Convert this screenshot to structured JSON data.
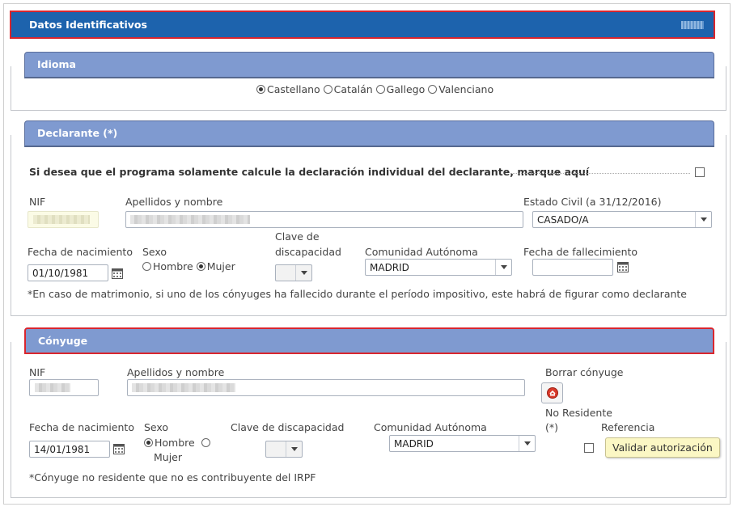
{
  "main": {
    "title": "Datos Identificativos"
  },
  "idioma": {
    "title": "Idioma",
    "options": [
      "Castellano",
      "Catalán",
      "Gallego",
      "Valenciano"
    ],
    "selected": "Castellano"
  },
  "declarante": {
    "title": "Declarante (*)",
    "individual_text": "Si desea que el programa solamente calcule la declaración individual del declarante, marque aquí",
    "nif_label": "NIF",
    "nombre_label": "Apellidos y nombre",
    "estado_civil_label": "Estado Civil (a 31/12/2016)",
    "estado_civil_value": "CASADO/A",
    "fecha_nac_label": "Fecha de nacimiento",
    "fecha_nac_value": "01/10/1981",
    "sexo_label": "Sexo",
    "sexo_hombre": "Hombre",
    "sexo_mujer": "Mujer",
    "sexo_selected": "Mujer",
    "discapacidad_label_1": "Clave de",
    "discapacidad_label_2": "discapacidad",
    "comunidad_label": "Comunidad Autónoma",
    "comunidad_value": "MADRID",
    "fallecimiento_label": "Fecha de fallecimiento",
    "note": "*En caso de matrimonio, si uno de los cónyuges ha fallecido durante el período impositivo, este habrá de figurar como declarante"
  },
  "conyuge": {
    "title": "Cónyuge",
    "nif_label": "NIF",
    "nombre_label": "Apellidos y nombre",
    "borrar_label": "Borrar cónyuge",
    "fecha_nac_label": "Fecha de nacimiento",
    "fecha_nac_value": "14/01/1981",
    "sexo_label": "Sexo",
    "sexo_hombre": "Hombre",
    "sexo_mujer": "Mujer",
    "sexo_selected": "Hombre",
    "discapacidad_label": "Clave de discapacidad",
    "comunidad_label": "Comunidad Autónoma",
    "comunidad_value": "MADRID",
    "no_residente_label_1": "No Residente",
    "no_residente_label_2": "(*)",
    "referencia_label": "Referencia",
    "validar_tooltip": "Validar autorización",
    "note": "*Cónyuge no residente que no es contribuyente del IRPF"
  },
  "colors": {
    "header_blue": "#1d63ad",
    "section_blue": "#7f9ad0",
    "highlight_red": "#d9262e"
  },
  "icons": [
    "collapse-icon",
    "calendar-icon",
    "chevron-down-icon",
    "delete-spouse-icon"
  ]
}
